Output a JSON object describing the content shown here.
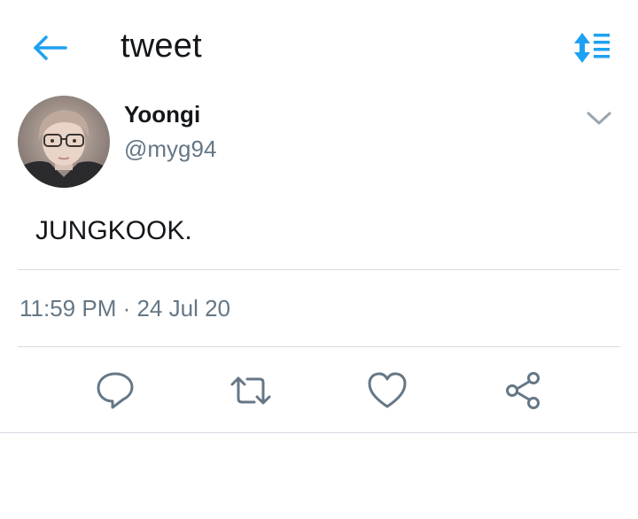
{
  "header": {
    "title": "tweet",
    "back_icon": "arrow-left-icon",
    "sort_icon": "sort-order-icon"
  },
  "colors": {
    "accent": "#1da1f2",
    "text_primary": "#14171a",
    "text_secondary": "#657786",
    "divider": "#d6dde3"
  },
  "author": {
    "display_name": "Yoongi",
    "handle": "@myg94"
  },
  "tweet": {
    "text": "JUNGKOOK.",
    "timestamp": "11:59 PM · 24 Jul 20"
  },
  "actions": [
    {
      "name": "reply",
      "icon": "reply-bubble-icon"
    },
    {
      "name": "retweet",
      "icon": "retweet-icon"
    },
    {
      "name": "like",
      "icon": "heart-icon"
    },
    {
      "name": "share",
      "icon": "share-icon"
    }
  ]
}
